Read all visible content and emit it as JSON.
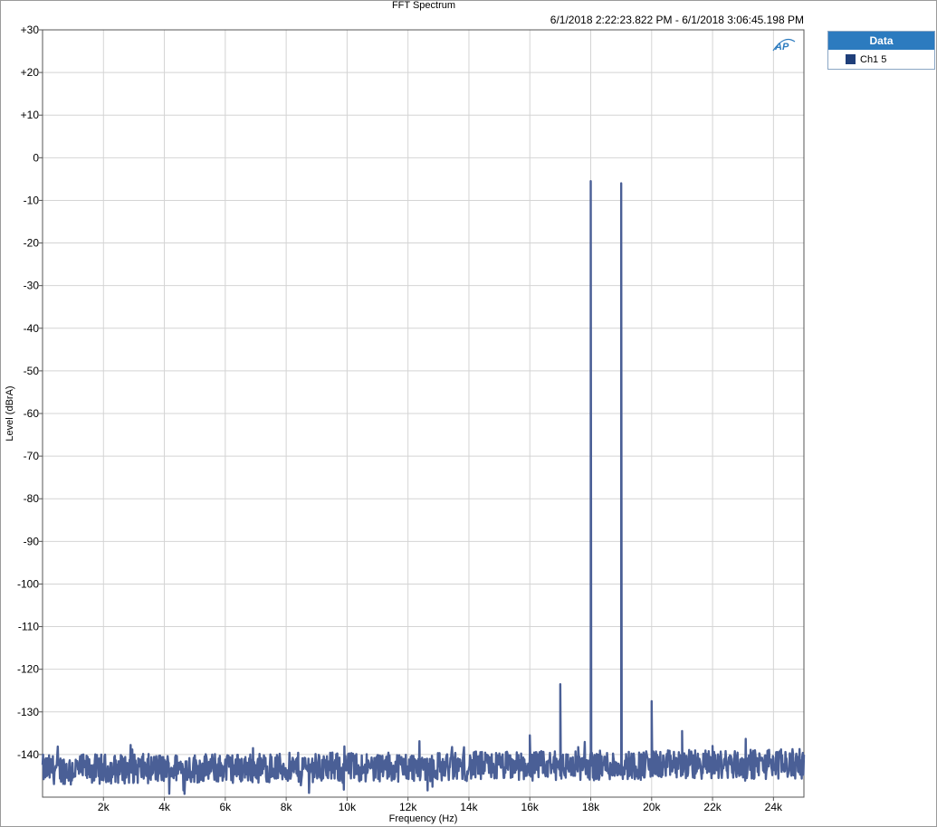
{
  "chart_data": {
    "type": "line",
    "title": "FFT Spectrum",
    "subtitle": "6/1/2018 2:22:23.822 PM - 6/1/2018 3:06:45.198 PM",
    "xlabel": "Frequency (Hz)",
    "ylabel": "Level (dBrA)",
    "xlim": [
      0,
      25000
    ],
    "ylim": [
      -150,
      30
    ],
    "x_ticks": [
      {
        "value": 2000,
        "label": "2k"
      },
      {
        "value": 4000,
        "label": "4k"
      },
      {
        "value": 6000,
        "label": "6k"
      },
      {
        "value": 8000,
        "label": "8k"
      },
      {
        "value": 10000,
        "label": "10k"
      },
      {
        "value": 12000,
        "label": "12k"
      },
      {
        "value": 14000,
        "label": "14k"
      },
      {
        "value": 16000,
        "label": "16k"
      },
      {
        "value": 18000,
        "label": "18k"
      },
      {
        "value": 20000,
        "label": "20k"
      },
      {
        "value": 22000,
        "label": "22k"
      },
      {
        "value": 24000,
        "label": "24k"
      }
    ],
    "y_ticks": [
      {
        "value": 30,
        "label": "+30"
      },
      {
        "value": 20,
        "label": "+20"
      },
      {
        "value": 10,
        "label": "+10"
      },
      {
        "value": 0,
        "label": "0"
      },
      {
        "value": -10,
        "label": "-10"
      },
      {
        "value": -20,
        "label": "-20"
      },
      {
        "value": -30,
        "label": "-30"
      },
      {
        "value": -40,
        "label": "-40"
      },
      {
        "value": -50,
        "label": "-50"
      },
      {
        "value": -60,
        "label": "-60"
      },
      {
        "value": -70,
        "label": "-70"
      },
      {
        "value": -80,
        "label": "-80"
      },
      {
        "value": -90,
        "label": "-90"
      },
      {
        "value": -100,
        "label": "-100"
      },
      {
        "value": -110,
        "label": "-110"
      },
      {
        "value": -120,
        "label": "-120"
      },
      {
        "value": -130,
        "label": "-130"
      },
      {
        "value": -140,
        "label": "-140"
      }
    ],
    "grid": true,
    "legend_position": "outside-top-right",
    "legend_title": "Data",
    "series": [
      {
        "name": "Ch1 5",
        "color": "#4a5f96",
        "noise_floor_db": -143.5,
        "noise_spread_db": 3.5,
        "peaks": [
          {
            "x": 16000,
            "y": -135.5
          },
          {
            "x": 17000,
            "y": -123.5
          },
          {
            "x": 18000,
            "y": -5.5
          },
          {
            "x": 19000,
            "y": -6
          },
          {
            "x": 20000,
            "y": -127.5
          },
          {
            "x": 21000,
            "y": -134.5
          },
          {
            "x": 22000,
            "y": -138
          }
        ]
      }
    ]
  }
}
